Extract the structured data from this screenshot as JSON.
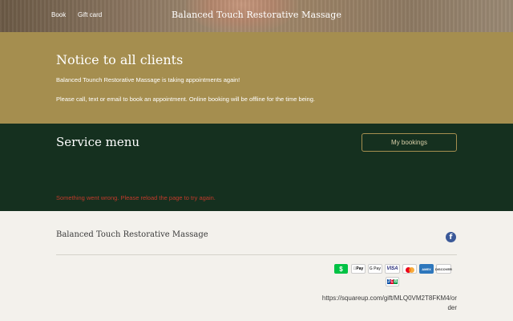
{
  "header": {
    "nav": [
      {
        "label": "Book"
      },
      {
        "label": "Gift card"
      }
    ],
    "site_title": "Balanced Touch Restorative Massage"
  },
  "notice": {
    "title": "Notice to all clients",
    "line1": "Balanced Tounch Restorative Massage is taking appointments again!",
    "line2": "Please call, text or email to book an appointment. Online booking will be offline for the time being."
  },
  "service": {
    "title": "Service menu",
    "bookings_button": "My bookings",
    "error": "Something went wrong. Please reload the page to try again."
  },
  "footer": {
    "title": "Balanced Touch Restorative Massage",
    "payments": {
      "cash": "$",
      "apple": "Pay",
      "google": "G Pay",
      "visa": "VISA",
      "amex": "AMEX",
      "discover": "DISCOVER",
      "jcb_j": "J",
      "jcb_c": "C",
      "jcb_b": "B"
    },
    "url": "https://squareup.com/gift/MLQ0VM2T8FKM4/order"
  },
  "icons": {
    "facebook": "facebook-icon",
    "apple_glyph": "apple-icon"
  },
  "colors": {
    "notice_bg": "#a58e4f",
    "service_bg": "#15301f",
    "footer_bg": "#f3f1ec",
    "error": "#c23a2b",
    "facebook": "#3b5998"
  }
}
